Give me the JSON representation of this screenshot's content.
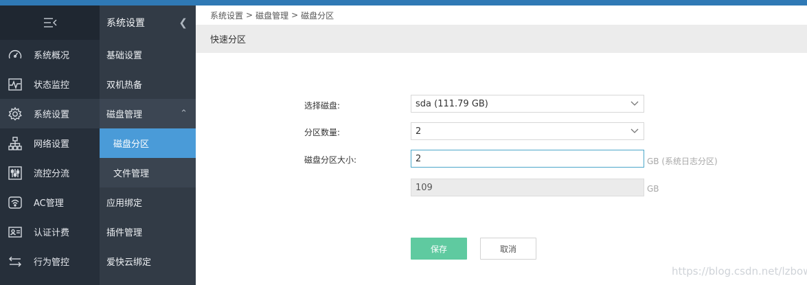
{
  "breadcrumb": [
    "系统设置",
    ">",
    "磁盘管理",
    ">",
    "磁盘分区"
  ],
  "section_title": "快速分区",
  "primary_nav": [
    {
      "label": "系统概况",
      "icon": "gauge-icon"
    },
    {
      "label": "状态监控",
      "icon": "pulse-icon"
    },
    {
      "label": "系统设置",
      "icon": "gear-icon",
      "active": true
    },
    {
      "label": "网络设置",
      "icon": "network-icon"
    },
    {
      "label": "流控分流",
      "icon": "sliders-icon"
    },
    {
      "label": "AC管理",
      "icon": "wifi-icon"
    },
    {
      "label": "认证计费",
      "icon": "id-card-icon"
    },
    {
      "label": "行为管控",
      "icon": "arrows-icon"
    }
  ],
  "secondary_nav": {
    "title": "系统设置",
    "items": [
      {
        "label": "基础设置"
      },
      {
        "label": "双机热备"
      },
      {
        "label": "磁盘管理"
      },
      {
        "label": "磁盘分区"
      },
      {
        "label": "文件管理"
      },
      {
        "label": "应用绑定"
      },
      {
        "label": "插件管理"
      },
      {
        "label": "爱快云绑定"
      }
    ]
  },
  "form": {
    "disk_label": "选择磁盘:",
    "disk_value": "sda (111.79 GB)",
    "count_label": "分区数量:",
    "count_value": "2",
    "size_label": "磁盘分区大小:",
    "size_value": "2",
    "size_unit": "GB (系统日志分区)",
    "remaining_value": "109",
    "remaining_unit": "GB"
  },
  "buttons": {
    "save": "保存",
    "cancel": "取消"
  },
  "watermark": "https://blog.csdn.net/lzbow",
  "colors": {
    "topbar": "#2f79b5",
    "selected": "#4a9bd8",
    "save": "#5fcaa0"
  }
}
